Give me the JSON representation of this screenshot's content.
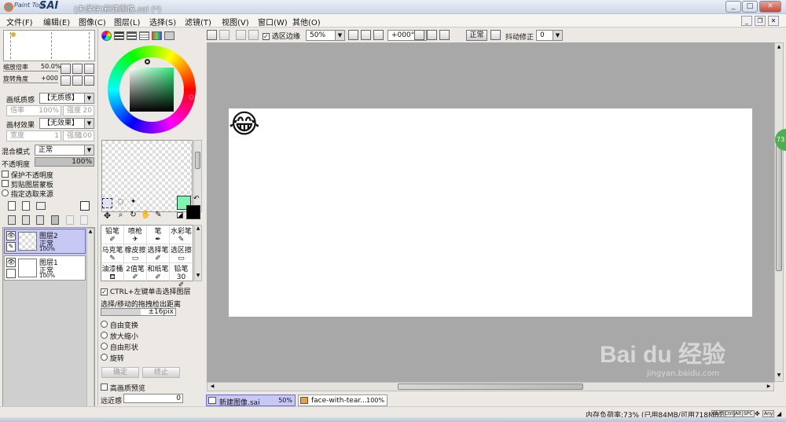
{
  "app": {
    "logo_small": "Paint Tool",
    "logo_big": "SAI",
    "window_title": "(未保存)新建图像.sai (*)"
  },
  "window_controls": {
    "minimize": "_",
    "maximize": "□",
    "close": "✕"
  },
  "menu": [
    "文件(F)",
    "编辑(E)",
    "图像(C)",
    "图层(L)",
    "选择(S)",
    "滤镜(T)",
    "视图(V)",
    "窗口(W)",
    "其他(O)"
  ],
  "nav": {
    "zoom_label": "缩放倍率",
    "zoom_value": "50.0%",
    "rotate_label": "旋转角度",
    "rotate_value": "+000"
  },
  "texture": {
    "paper_label": "画纸质感",
    "paper_value": "【无质感】",
    "paper_scale_label": "倍率",
    "paper_scale_value": "100%",
    "paper_strength_label": "强度",
    "paper_strength_value": "20",
    "effect_label": "画材效果",
    "effect_value": "【无效果】",
    "effect_width_label": "宽度",
    "effect_width_value": "1",
    "effect_strength_label": "强度",
    "effect_strength_value": "100"
  },
  "blend": {
    "mode_label": "混合模式",
    "mode_value": "正常",
    "opacity_label": "不透明度",
    "opacity_value": "100%",
    "opacity_level": 1.0
  },
  "layer_options": [
    "保护不透明度",
    "剪贴图层蒙板",
    "指定选取来源"
  ],
  "layers": [
    {
      "name": "图层2",
      "mode": "正常",
      "opacity": "100%",
      "selected": true
    },
    {
      "name": "图层1",
      "mode": "正常",
      "opacity": "100%",
      "selected": false
    }
  ],
  "tools": [
    {
      "name": "铅笔",
      "icon": "pencil-icon"
    },
    {
      "name": "喷枪",
      "icon": "airbrush-icon"
    },
    {
      "name": "笔",
      "icon": "pen-icon"
    },
    {
      "name": "水彩笔",
      "icon": "watercolor-icon"
    },
    {
      "name": "马克笔",
      "icon": "marker-icon"
    },
    {
      "name": "橡皮擦",
      "icon": "eraser-icon"
    },
    {
      "name": "选择笔",
      "icon": "select-pen-icon"
    },
    {
      "name": "选区擦",
      "icon": "select-eraser-icon"
    },
    {
      "name": "油漆桶",
      "icon": "bucket-icon"
    },
    {
      "name": "2值笔",
      "icon": "binary-pen-icon"
    },
    {
      "name": "和纸笔",
      "icon": "washi-pen-icon"
    },
    {
      "name": "铅笔30",
      "icon": "pencil-icon"
    }
  ],
  "tool_options": {
    "ctrl_select_label": "CTRL+左键单击选择图层",
    "drag_label": "选择/移动的拖拽检出距离",
    "drag_value": "±16pix",
    "transforms": [
      "自由变换",
      "放大缩小",
      "自由形状",
      "旋转"
    ],
    "ok_label": "确定",
    "cancel_label": "终止",
    "hq_preview_label": "高画质预览",
    "perspective_label": "远近感",
    "perspective_value": "0"
  },
  "colors": {
    "foreground": "#7df5b0",
    "background": "#000000",
    "canvas_bg": "#a8a8a8",
    "layer_selected": "#c8c8f4"
  },
  "toolbar": {
    "selection_edge_label": "选区边缘",
    "zoom_value": "50%",
    "angle_value": "+000°",
    "mode_label": "正常",
    "stabilizer_label": "抖动修正",
    "stabilizer_value": "0"
  },
  "canvas": {
    "emoji": "😂"
  },
  "doc_tabs": [
    {
      "name": "新建图像.sai",
      "zoom": "50%",
      "active": true
    },
    {
      "name": "face-with-tear...",
      "zoom": "100%",
      "active": false
    }
  ],
  "status": {
    "memory": "内存负荷率:73% (已用84MB/可用718MB)",
    "keys": [
      "Shift",
      "Ctrl",
      "Alt",
      "SPC",
      "Any"
    ]
  },
  "side_badge": "73",
  "watermark": {
    "brand": "Bai du 经验",
    "url": "jingyan.baidu.com"
  }
}
